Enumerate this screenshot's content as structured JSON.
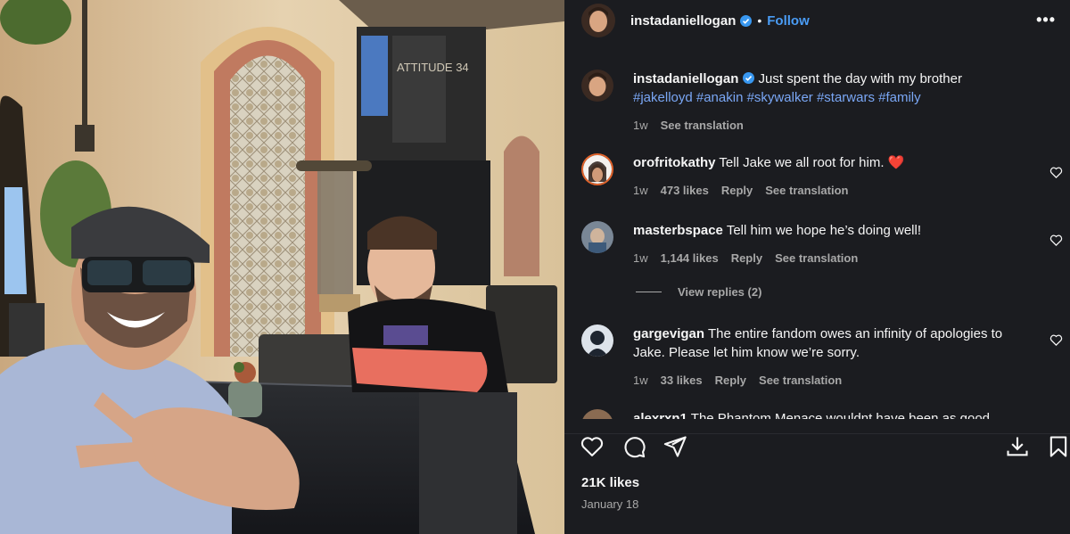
{
  "post": {
    "author": "instadaniellogan",
    "follow_label": "Follow",
    "separator": "•",
    "more_label": "•••",
    "caption_text": "Just spent the day with my brother",
    "hashtags": "#jakelloyd #anakin #skywalker #starwars #family",
    "caption_time": "1w",
    "see_translation": "See translation",
    "likes": "21K likes",
    "date": "January 18",
    "storefront_sign": "ATTITUDE 34"
  },
  "comments": [
    {
      "user": "orofritokathy",
      "text": "Tell Jake we all root for him. ❤️",
      "time": "1w",
      "likes": "473 likes",
      "reply": "Reply",
      "translate": "See translation"
    },
    {
      "user": "masterbspace",
      "text": "Tell him we hope he’s doing well!",
      "time": "1w",
      "likes": "1,144 likes",
      "reply": "Reply",
      "translate": "See translation"
    },
    {
      "user": "gargevigan",
      "text": "The entire fandom owes an infinity of apologies to Jake. Please let him know we’re sorry.",
      "time": "1w",
      "likes": "33 likes",
      "reply": "Reply",
      "translate": "See translation"
    },
    {
      "user": "alexrxn1",
      "text": "The Phantom Menace wouldnt have been as good"
    }
  ],
  "view_replies": "View replies (2)",
  "colors": {
    "accent": "#4a9cf5",
    "hashtag": "#7aa7f5",
    "background": "#1b1c20",
    "muted": "#a8a8a8",
    "heart": "#e8262f"
  },
  "icons": [
    "heart-icon",
    "comment-icon",
    "share-icon",
    "download-icon",
    "bookmark-icon",
    "verified-icon",
    "more-icon"
  ]
}
